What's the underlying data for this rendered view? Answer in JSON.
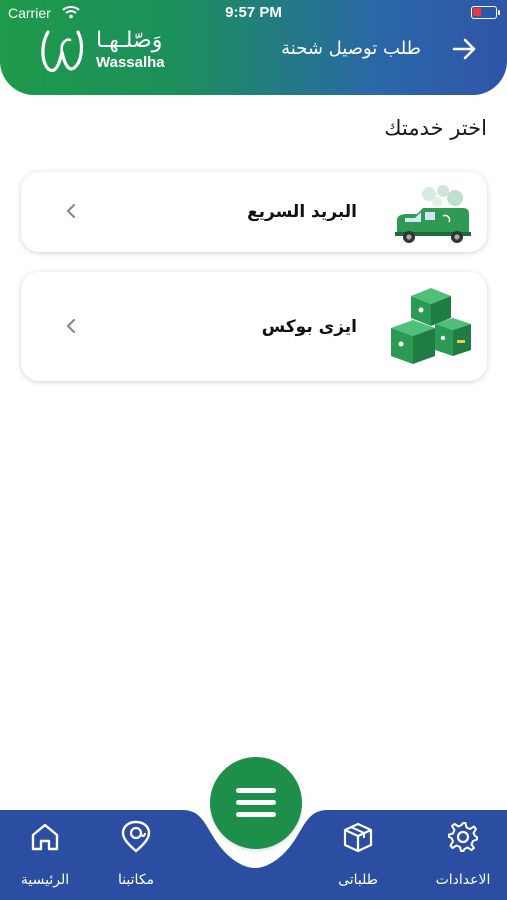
{
  "status_bar": {
    "carrier": "Carrier",
    "time": "9:57 PM"
  },
  "header": {
    "title": "طلب توصيل شحنة",
    "logo_arabic": "وَصّلـهـا",
    "logo_latin": "Wassalha"
  },
  "page": {
    "section_title": "اختر خدمتك"
  },
  "services": [
    {
      "label": "البريد السريع",
      "icon": "delivery-van"
    },
    {
      "label": "ايزى بوكس",
      "icon": "boxes"
    }
  ],
  "bottom_nav": {
    "items": [
      {
        "label": "الرئيسية",
        "icon": "home-icon"
      },
      {
        "label": "مكاتبنا",
        "icon": "location-at-icon"
      },
      {
        "label": "طلباتى",
        "icon": "box-icon"
      },
      {
        "label": "الاعدادات",
        "icon": "gear-icon"
      }
    ],
    "menu_icon": "menu-icon"
  },
  "colors": {
    "brand_green": "#1e8f4a",
    "brand_blue": "#2f55a8",
    "nav_blue": "#2b4ea3"
  }
}
